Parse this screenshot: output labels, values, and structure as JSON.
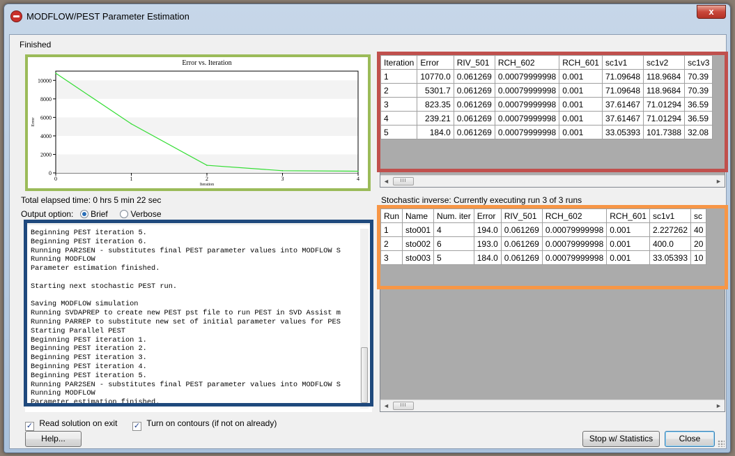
{
  "window": {
    "title": "MODFLOW/PEST Parameter Estimation",
    "close_glyph": "x"
  },
  "status": {
    "finished": "Finished",
    "elapsed": "Total elapsed time: 0 hrs 5 min 22 sec",
    "stochastic": "Stochastic inverse: Currently executing run 3 of 3 runs"
  },
  "chart_data": {
    "type": "line",
    "title": "Error vs. Iteration",
    "xlabel": "Iteration",
    "ylabel": "Error",
    "x": [
      0,
      1,
      2,
      3,
      4
    ],
    "y": [
      10770.0,
      5301.7,
      823.35,
      239.21,
      184.0
    ],
    "xlim": [
      0,
      4
    ],
    "ylim": [
      0,
      11000
    ],
    "xticks": [
      "0",
      "1",
      "2",
      "3",
      "4"
    ],
    "yticks": [
      "0",
      "2000",
      "4000",
      "6000",
      "8000",
      "10000"
    ],
    "series_color": "#33dd33",
    "grid": "horizontal bands"
  },
  "output_option": {
    "label": "Output option:",
    "brief": "Brief",
    "verbose": "Verbose",
    "selected": "Brief"
  },
  "log": {
    "text": "Beginning PEST iteration 5.\nBeginning PEST iteration 6.\nRunning PAR2SEN - substitutes final PEST parameter values into MODFLOW S\nRunning MODFLOW\nParameter estimation finished.\n\nStarting next stochastic PEST run.\n\nSaving MODFLOW simulation\nRunning SVDAPREP to create new PEST pst file to run PEST in SVD Assist m\nRunning PARREP to substitute new set of initial parameter values for PES\nStarting Parallel PEST\nBeginning PEST iteration 1.\nBeginning PEST iteration 2.\nBeginning PEST iteration 3.\nBeginning PEST iteration 4.\nBeginning PEST iteration 5.\nRunning PAR2SEN - substitutes final PEST parameter values into MODFLOW S\nRunning MODFLOW\nParameter estimation finished."
  },
  "iteration_table": {
    "columns": [
      "Iteration",
      "Error",
      "RIV_501",
      "RCH_602",
      "RCH_601",
      "sc1v1",
      "sc1v2",
      "sc1v3"
    ],
    "rows": [
      [
        "1",
        "10770.0",
        "0.061269",
        "0.00079999998",
        "0.001",
        "71.09648",
        "118.9684",
        "70.39"
      ],
      [
        "2",
        "5301.7",
        "0.061269",
        "0.00079999998",
        "0.001",
        "71.09648",
        "118.9684",
        "70.39"
      ],
      [
        "3",
        "823.35",
        "0.061269",
        "0.00079999998",
        "0.001",
        "37.61467",
        "71.01294",
        "36.59"
      ],
      [
        "4",
        "239.21",
        "0.061269",
        "0.00079999998",
        "0.001",
        "37.61467",
        "71.01294",
        "36.59"
      ],
      [
        "5",
        "184.0",
        "0.061269",
        "0.00079999998",
        "0.001",
        "33.05393",
        "101.7388",
        "32.08"
      ]
    ]
  },
  "runs_table": {
    "columns": [
      "Run",
      "Name",
      "Num. iter",
      "Error",
      "RIV_501",
      "RCH_602",
      "RCH_601",
      "sc1v1",
      "sc"
    ],
    "rows": [
      [
        "1",
        "sto001",
        "4",
        "194.0",
        "0.061269",
        "0.00079999998",
        "0.001",
        "2.227262",
        "40"
      ],
      [
        "2",
        "sto002",
        "6",
        "193.0",
        "0.061269",
        "0.00079999998",
        "0.001",
        "400.0",
        "20"
      ],
      [
        "3",
        "sto003",
        "5",
        "184.0",
        "0.061269",
        "0.00079999998",
        "0.001",
        "33.05393",
        "10"
      ]
    ]
  },
  "options": {
    "read_solution": "Read solution on exit",
    "contours": "Turn on contours (if not on already)",
    "read_checked": true,
    "contours_checked": true
  },
  "buttons": {
    "help": "Help...",
    "stop": "Stop w/ Statistics",
    "close": "Close"
  },
  "scroll": {
    "thumb_glyph": "III",
    "left_arrow": "◄",
    "right_arrow": "►"
  },
  "colors": {
    "highlight_chart": "#9bbb59",
    "highlight_iter_table": "#c0504d",
    "highlight_runs_table": "#f79646",
    "highlight_log": "#1f497d"
  }
}
